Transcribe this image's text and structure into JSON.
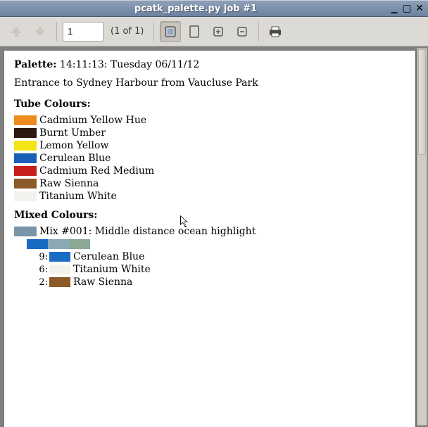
{
  "window": {
    "title": "pcatk_palette.py job #1"
  },
  "toolbar": {
    "page_value": "1",
    "page_label": "(1 of 1)"
  },
  "document": {
    "palette_label": "Palette:",
    "timestamp": "14:11:13:",
    "date": "Tuesday 06/11/12",
    "description": "Entrance to Sydney Harbour from Vaucluse Park",
    "tube_section": "Tube Colours:",
    "tubes": [
      {
        "name": "Cadmium Yellow Hue",
        "colour": "#f08c1f"
      },
      {
        "name": "Burnt Umber",
        "colour": "#2c1a0e"
      },
      {
        "name": "Lemon Yellow",
        "colour": "#f3e415"
      },
      {
        "name": "Cerulean Blue",
        "colour": "#1a5fb8"
      },
      {
        "name": "Cadmium Red Medium",
        "colour": "#c91e1e"
      },
      {
        "name": "Raw Sienna",
        "colour": "#8a5a27"
      },
      {
        "name": "Titanium White",
        "colour": "#f4f2ec"
      }
    ],
    "mixed_section": "Mixed Colours:",
    "mixed": [
      {
        "label": "Mix #001: Middle distance ocean highlight",
        "swatch": "#7b95a8",
        "strip": [
          "#1a6bc4",
          "#8aa9b4",
          "#8aa894"
        ],
        "components": [
          {
            "ratio": "9:",
            "colour": "#1a6bc4",
            "name": "Cerulean Blue"
          },
          {
            "ratio": "6:",
            "colour": "#f4f2ec",
            "name": "Titanium White"
          },
          {
            "ratio": "2:",
            "colour": "#8a5a27",
            "name": "Raw Sienna"
          }
        ]
      }
    ]
  }
}
